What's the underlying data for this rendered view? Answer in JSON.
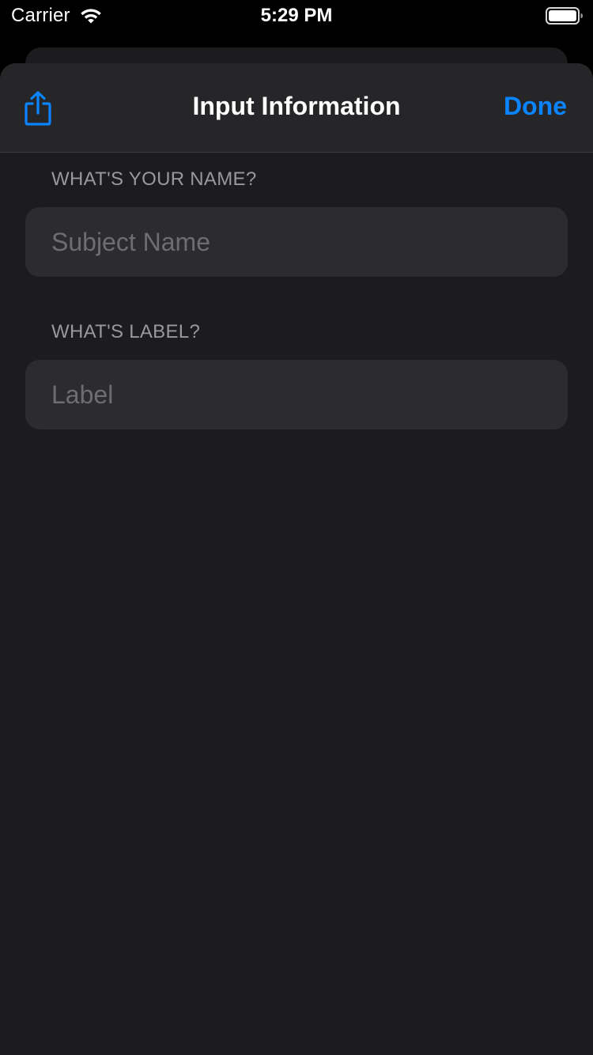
{
  "status_bar": {
    "carrier": "Carrier",
    "time": "5:29 PM",
    "wifi_icon": "wifi-icon",
    "battery_icon": "battery-icon"
  },
  "nav": {
    "share_icon": "share-icon",
    "title": "Input Information",
    "done_label": "Done"
  },
  "form": {
    "name_section": {
      "header": "WHAT'S YOUR NAME?",
      "placeholder": "Subject Name",
      "value": ""
    },
    "label_section": {
      "header": "WHAT'S LABEL?",
      "placeholder": "Label",
      "value": ""
    }
  },
  "colors": {
    "accent": "#0a84ff",
    "background": "#1c1c1e",
    "nav_background": "#262628",
    "field_background": "#2c2c2e",
    "section_text": "#98989e",
    "placeholder_text": "#6d6d72"
  }
}
